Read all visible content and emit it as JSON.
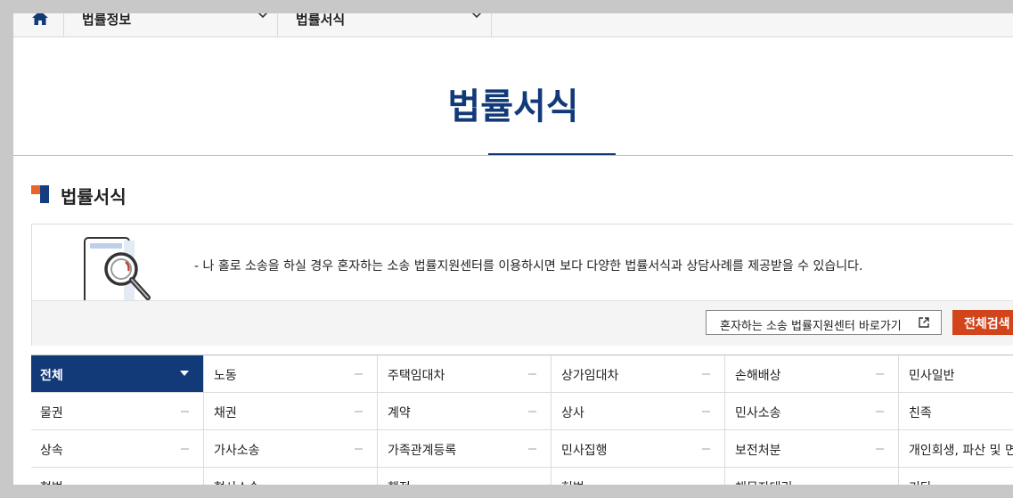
{
  "nav": {
    "menu1": "법률정보",
    "menu2": "법률서식"
  },
  "page_title": "법률서식",
  "section_title": "법률서식",
  "info": {
    "message": "- 나 홀로 소송을 하실 경우 혼자하는 소송 법률지원센터를 이용하시면 보다 다양한 법률서식과 상담사례를 제공받을 수 있습니다.",
    "link_button": "혼자하는 소송 법률지원센터 바로가기",
    "all_search_button": "전체검색"
  },
  "categories": [
    [
      "전체",
      "노동",
      "주택임대차",
      "상가임대차",
      "손해배상",
      "민사일반"
    ],
    [
      "물권",
      "채권",
      "계약",
      "상사",
      "민사소송",
      "친족"
    ],
    [
      "상속",
      "가사소송",
      "가족관계등록",
      "민사집행",
      "보전처분",
      "개인회생, 파산 및 면책"
    ],
    [
      "형법",
      "형사소송",
      "행정",
      "헌법",
      "채무자대리",
      "기타"
    ]
  ],
  "colors": {
    "brand": "#133a78",
    "accent": "#d2441b",
    "icon_orange": "#e8642a"
  }
}
